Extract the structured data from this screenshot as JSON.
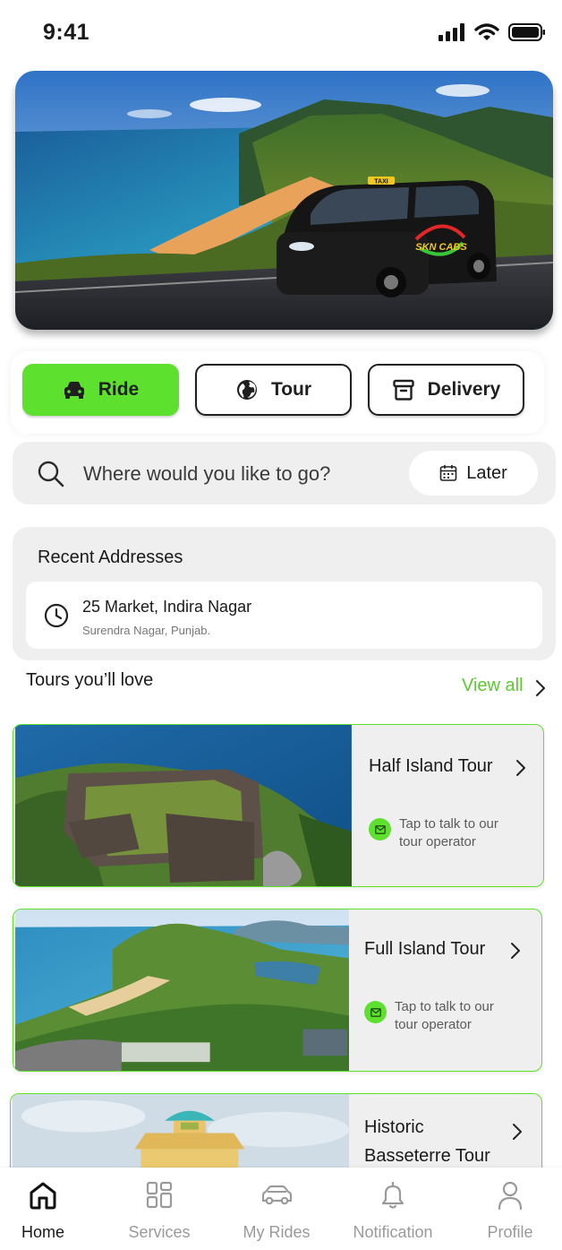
{
  "status_bar": {
    "time": "9:41"
  },
  "hero": {
    "vehicle_sign": "TAXI",
    "vehicle_brand": "SKN CABS"
  },
  "modes": [
    {
      "label": "Ride",
      "icon": "car-icon",
      "active": true
    },
    {
      "label": "Tour",
      "icon": "globe-icon",
      "active": false
    },
    {
      "label": "Delivery",
      "icon": "archive-box-icon",
      "active": false
    }
  ],
  "search": {
    "placeholder": "Where would you like to go?",
    "later_label": "Later"
  },
  "recent": {
    "title": "Recent Addresses",
    "items": [
      {
        "primary": "25 Market, Indira Nagar",
        "secondary": "Surendra Nagar, Punjab."
      }
    ]
  },
  "tours": {
    "heading": "Tours you’ll love",
    "view_all": "View all",
    "items": [
      {
        "title": "Half Island Tour",
        "contact": "Tap to talk to our tour operator"
      },
      {
        "title": "Full Island Tour",
        "contact": "Tap to talk to our tour operator"
      },
      {
        "title_line1": "Historic",
        "title_line2": "Basseterre Tour"
      }
    ]
  },
  "nav": {
    "items": [
      {
        "label": "Home",
        "icon": "home-icon",
        "active": true
      },
      {
        "label": "Services",
        "icon": "grid-icon",
        "active": false
      },
      {
        "label": "My Rides",
        "icon": "car-outline-icon",
        "active": false
      },
      {
        "label": "Notification",
        "icon": "bell-icon",
        "active": false
      },
      {
        "label": "Profile",
        "icon": "user-icon",
        "active": false
      }
    ]
  },
  "colors": {
    "accent": "#5ee12e",
    "accent_text": "#5cc92f",
    "panel": "#efefef"
  }
}
